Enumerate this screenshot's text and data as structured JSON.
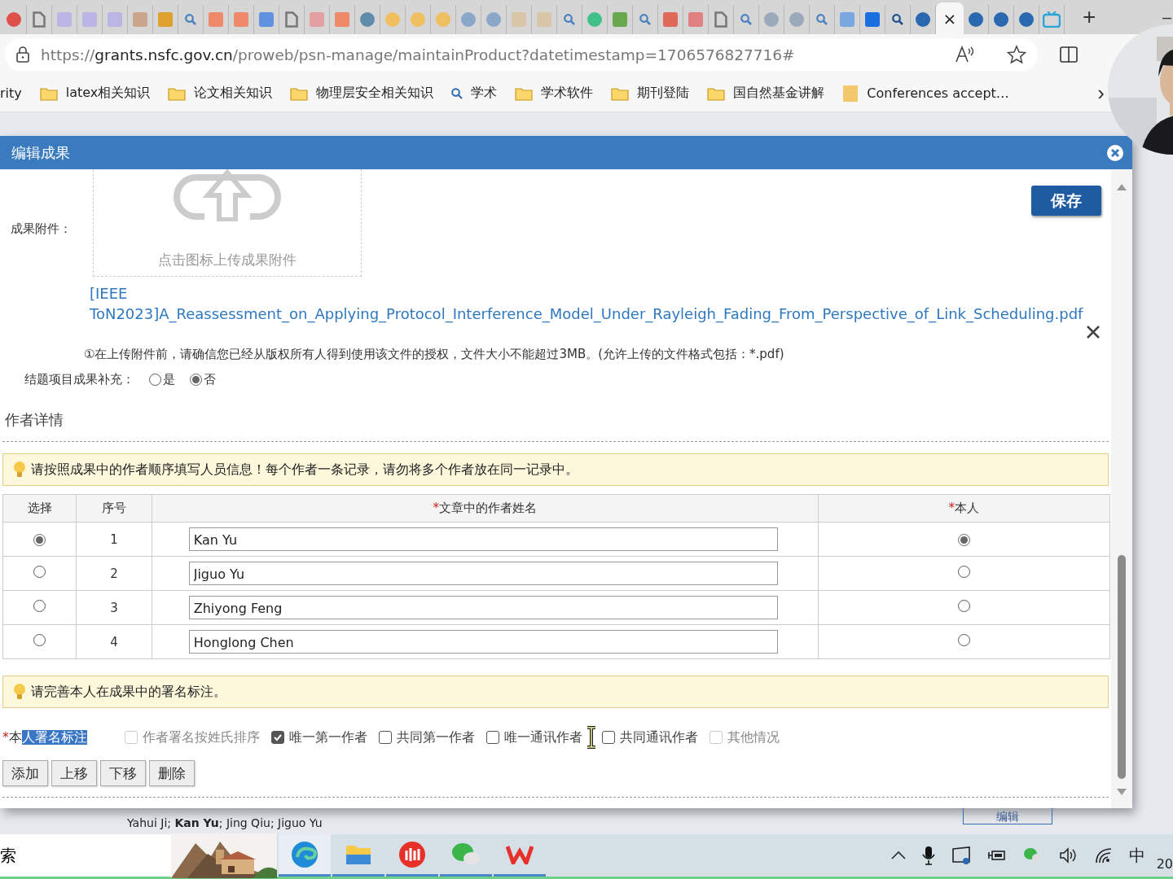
{
  "browser": {
    "tabs": [
      {
        "kind": "circle",
        "color": "#e0504a",
        "selected": false
      },
      {
        "kind": "doc",
        "color": "#777777",
        "selected": false
      },
      {
        "kind": "square",
        "color": "#b9b6e6",
        "selected": false
      },
      {
        "kind": "square",
        "color": "#b9b6e6",
        "selected": false
      },
      {
        "kind": "square",
        "color": "#b9b6e6",
        "selected": false
      },
      {
        "kind": "square",
        "color": "#c9a58a",
        "selected": false
      },
      {
        "kind": "square",
        "color": "#e0a030",
        "selected": false
      },
      {
        "kind": "search",
        "color": "#4a7fc0",
        "selected": false
      },
      {
        "kind": "square",
        "color": "#ee8a6a",
        "selected": false
      },
      {
        "kind": "square",
        "color": "#ee8a6a",
        "selected": false
      },
      {
        "kind": "square",
        "color": "#5f93e0",
        "selected": false
      },
      {
        "kind": "doc",
        "color": "#777777",
        "selected": false
      },
      {
        "kind": "square",
        "color": "#e3a0a0",
        "selected": false
      },
      {
        "kind": "square",
        "color": "#ee8a6a",
        "selected": false
      },
      {
        "kind": "circle",
        "color": "#5f8ca8",
        "selected": false
      },
      {
        "kind": "circle",
        "color": "#f0c060",
        "selected": false
      },
      {
        "kind": "circle",
        "color": "#f0c060",
        "selected": false
      },
      {
        "kind": "circle",
        "color": "#f0c060",
        "selected": false
      },
      {
        "kind": "circle",
        "color": "#8aa6c8",
        "selected": false
      },
      {
        "kind": "circle",
        "color": "#8aa6c8",
        "selected": false
      },
      {
        "kind": "square",
        "color": "#d9c6a8",
        "selected": false
      },
      {
        "kind": "square",
        "color": "#d9c6a8",
        "selected": false
      },
      {
        "kind": "search",
        "color": "#4a7fc0",
        "selected": false
      },
      {
        "kind": "circle",
        "color": "#44c08a",
        "selected": false
      },
      {
        "kind": "square",
        "color": "#6aa84f",
        "selected": false
      },
      {
        "kind": "search",
        "color": "#4a7fc0",
        "selected": false
      },
      {
        "kind": "square",
        "color": "#e06a5a",
        "selected": false
      },
      {
        "kind": "square",
        "color": "#e08080",
        "selected": false
      },
      {
        "kind": "doc",
        "color": "#777777",
        "selected": false
      },
      {
        "kind": "search",
        "color": "#4a7fc0",
        "selected": false
      },
      {
        "kind": "circle",
        "color": "#9aaabb",
        "selected": false
      },
      {
        "kind": "circle",
        "color": "#9aaabb",
        "selected": false
      },
      {
        "kind": "search",
        "color": "#4a7fc0",
        "selected": false
      },
      {
        "kind": "square",
        "color": "#7aa6e0",
        "selected": false
      },
      {
        "kind": "square",
        "color": "#1a6fe0",
        "selected": false
      },
      {
        "kind": "search",
        "color": "#1a4f90",
        "selected": false
      },
      {
        "kind": "circle",
        "color": "#2a68b0",
        "selected": false
      },
      {
        "kind": "close",
        "selected": true,
        "close": "×"
      },
      {
        "kind": "circle",
        "color": "#2a68b0",
        "selected": false
      },
      {
        "kind": "circle",
        "color": "#2a68b0",
        "selected": false
      },
      {
        "kind": "circle",
        "color": "#2a68b0",
        "selected": false
      },
      {
        "kind": "tv",
        "color": "#29a3d8",
        "selected": false
      }
    ],
    "new_tab": "+",
    "minimize": "–",
    "url": {
      "scheme": "https://",
      "host": "grants.nsfc.gov.cn",
      "path": "/proweb/psn-manage/maintainProduct?datetimestamp=1706576827716#"
    },
    "bookmarks": [
      {
        "kind": "text",
        "label": "rity"
      },
      {
        "kind": "folder",
        "label": "latex相关知识"
      },
      {
        "kind": "folder",
        "label": "论文相关知识"
      },
      {
        "kind": "folder",
        "label": "物理层安全相关知识"
      },
      {
        "kind": "search",
        "label": "学术"
      },
      {
        "kind": "folder",
        "label": "学术软件"
      },
      {
        "kind": "folder",
        "label": "期刊登陆"
      },
      {
        "kind": "folder",
        "label": "国自然基金讲解"
      },
      {
        "kind": "site",
        "label": "Conferences accept…"
      }
    ],
    "more": "›"
  },
  "dialog": {
    "title": "编辑成果",
    "save": "保存",
    "attachment": {
      "label": "成果附件：",
      "upload_hint": "点击图标上传成果附件",
      "file": "[IEEE ToN2023]A_Reassessment_on_Applying_Protocol_Interference_Model_Under_Rayleigh_Fading_From_Perspective_of_Link_Scheduling.pdf",
      "note": "①在上传附件前，请确信您已经从版权所有人得到使用该文件的授权，文件大小不能超过3MB。(允许上传的文件格式包括：*.pdf)"
    },
    "supplement": {
      "label": "结题项目成果补充：",
      "options": [
        {
          "label": "是",
          "selected": false
        },
        {
          "label": "否",
          "selected": true
        }
      ]
    },
    "section": "作者详情",
    "tip": "请按照成果中的作者顺序填写人员信息！每个作者一条记录，请勿将多个作者放在同一记录中。",
    "table": {
      "required_mark": "*",
      "columns": [
        {
          "label": "选择",
          "required": false
        },
        {
          "label": "序号",
          "required": false
        },
        {
          "label": "文章中的作者姓名",
          "required": true
        },
        {
          "label": "本人",
          "required": true
        }
      ],
      "rows": [
        {
          "selected": true,
          "index": "1",
          "name": "Kan Yu",
          "is_self": true
        },
        {
          "selected": false,
          "index": "2",
          "name": "Jiguo Yu",
          "is_self": false
        },
        {
          "selected": false,
          "index": "3",
          "name": "Zhiyong Feng",
          "is_self": false
        },
        {
          "selected": false,
          "index": "4",
          "name": "Honglong Chen",
          "is_self": false
        }
      ]
    },
    "tip2": "请完善本人在成果中的署名标注。",
    "signature": {
      "required": true,
      "required_mark": "*",
      "label": "本",
      "label_selected": "人署名标注",
      "options": [
        {
          "label": "作者署名按姓氏排序",
          "checked": false,
          "disabled": true
        },
        {
          "label": "唯一第一作者",
          "checked": true,
          "disabled": false
        },
        {
          "label": "共同第一作者",
          "checked": false,
          "disabled": false
        },
        {
          "label": "唯一通讯作者",
          "checked": false,
          "disabled": false
        },
        {
          "label": "共同通讯作者",
          "checked": false,
          "disabled": false
        },
        {
          "label": "其他情况",
          "checked": false,
          "disabled": true
        }
      ]
    },
    "buttons": [
      "添加",
      "上移",
      "下移",
      "删除"
    ]
  },
  "background": {
    "authors": "Yahui Ji; **Kan Yu**; Jing Qiu; Jiguo Yu",
    "edit": "编辑"
  },
  "taskbar": {
    "search": "索",
    "apps": [
      {
        "kind": "edge"
      },
      {
        "kind": "folder"
      },
      {
        "kind": "red"
      },
      {
        "kind": "chat"
      },
      {
        "kind": "zigzag"
      }
    ],
    "ime": "中",
    "clock": "20"
  }
}
